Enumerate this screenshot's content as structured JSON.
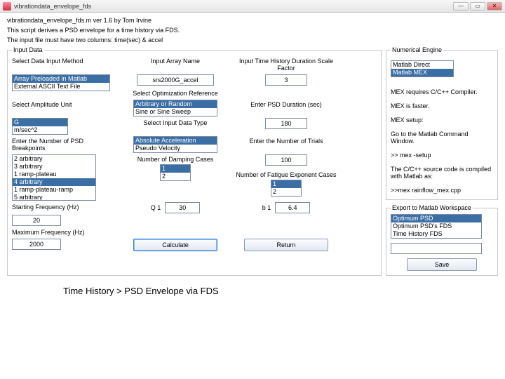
{
  "window": {
    "title": "vibrationdata_envelope_fds"
  },
  "header": {
    "line1": "vibrationdata_envelope_fds.m  ver 1.6  by Tom Irvine",
    "line2": "This script derives a PSD envelope for a time history via FDS.",
    "line3": "The input file must have two columns:  time(sec) & accel"
  },
  "input": {
    "legend": "Input Data",
    "selMethod_lbl": "Select Data Input Method",
    "selMethod_opts": [
      "Array Preloaded in Matlab",
      "External ASCII Text File"
    ],
    "selAmp_lbl": "Select Amplitude Unit",
    "selAmp_opts": [
      "G",
      "m/sec^2"
    ],
    "bp_lbl": "Enter the Number of PSD Breakpoints",
    "bp_opts": [
      "2 arbitrary",
      "3 arbitrary",
      "1 ramp-plateau",
      "4 arbitrary",
      "1 ramp-plateau-ramp",
      "5 arbitrary"
    ],
    "startF_lbl": "Starting Frequency (Hz)",
    "startF_val": "20",
    "maxF_lbl": "Maximum Frequency (Hz)",
    "maxF_val": "2000",
    "arrname_lbl": "Input Array Name",
    "arrname_val": "srs2000G_accel",
    "optref_lbl": "Select Optimization Reference",
    "optref_opts": [
      "Arbitrary or Random",
      "Sine or Sine Sweep"
    ],
    "intype_lbl": "Select Input Data Type",
    "intype_opts": [
      "Absolute Acceleration",
      "Pseudo Velocity"
    ],
    "damp_lbl": "Number of Damping Cases",
    "damp_opts": [
      "1",
      "2"
    ],
    "q_lbl": "Q 1",
    "q_val": "30",
    "scale_lbl": "Input Time History Duration Scale Factor",
    "scale_val": "3",
    "psddur_lbl": "Enter PSD Duration (sec)",
    "psddur_val": "180",
    "trials_lbl": "Enter the Number of Trials",
    "trials_val": "100",
    "fatigue_lbl": "Number of Fatigue Exponent Cases",
    "fatigue_opts": [
      "1",
      "2"
    ],
    "b_lbl": "b 1",
    "b_val": "6.4",
    "calc": "Calculate",
    "return": "Return"
  },
  "engine": {
    "legend": "Numerical Engine",
    "opts": [
      "Matlab Direct",
      "Matlab MEX"
    ],
    "t1": "MEX requires C/C++ Compiler.",
    "t2": "MEX is faster.",
    "t3": "MEX setup:",
    "t4": "Go to the Matlab Command Window.",
    "t5": ">> mex -setup",
    "t6": "The C/C++ source code is compiled with Matlab as:",
    "t7": ">>mex rainflow_mex.cpp"
  },
  "export": {
    "legend": "Export to Matlab Workspace",
    "opts": [
      "Optimum PSD",
      "Optimum PSD's FDS",
      "Time History FDS"
    ],
    "nameval": "",
    "save": "Save"
  },
  "footer": "Time History > PSD Envelope via FDS"
}
